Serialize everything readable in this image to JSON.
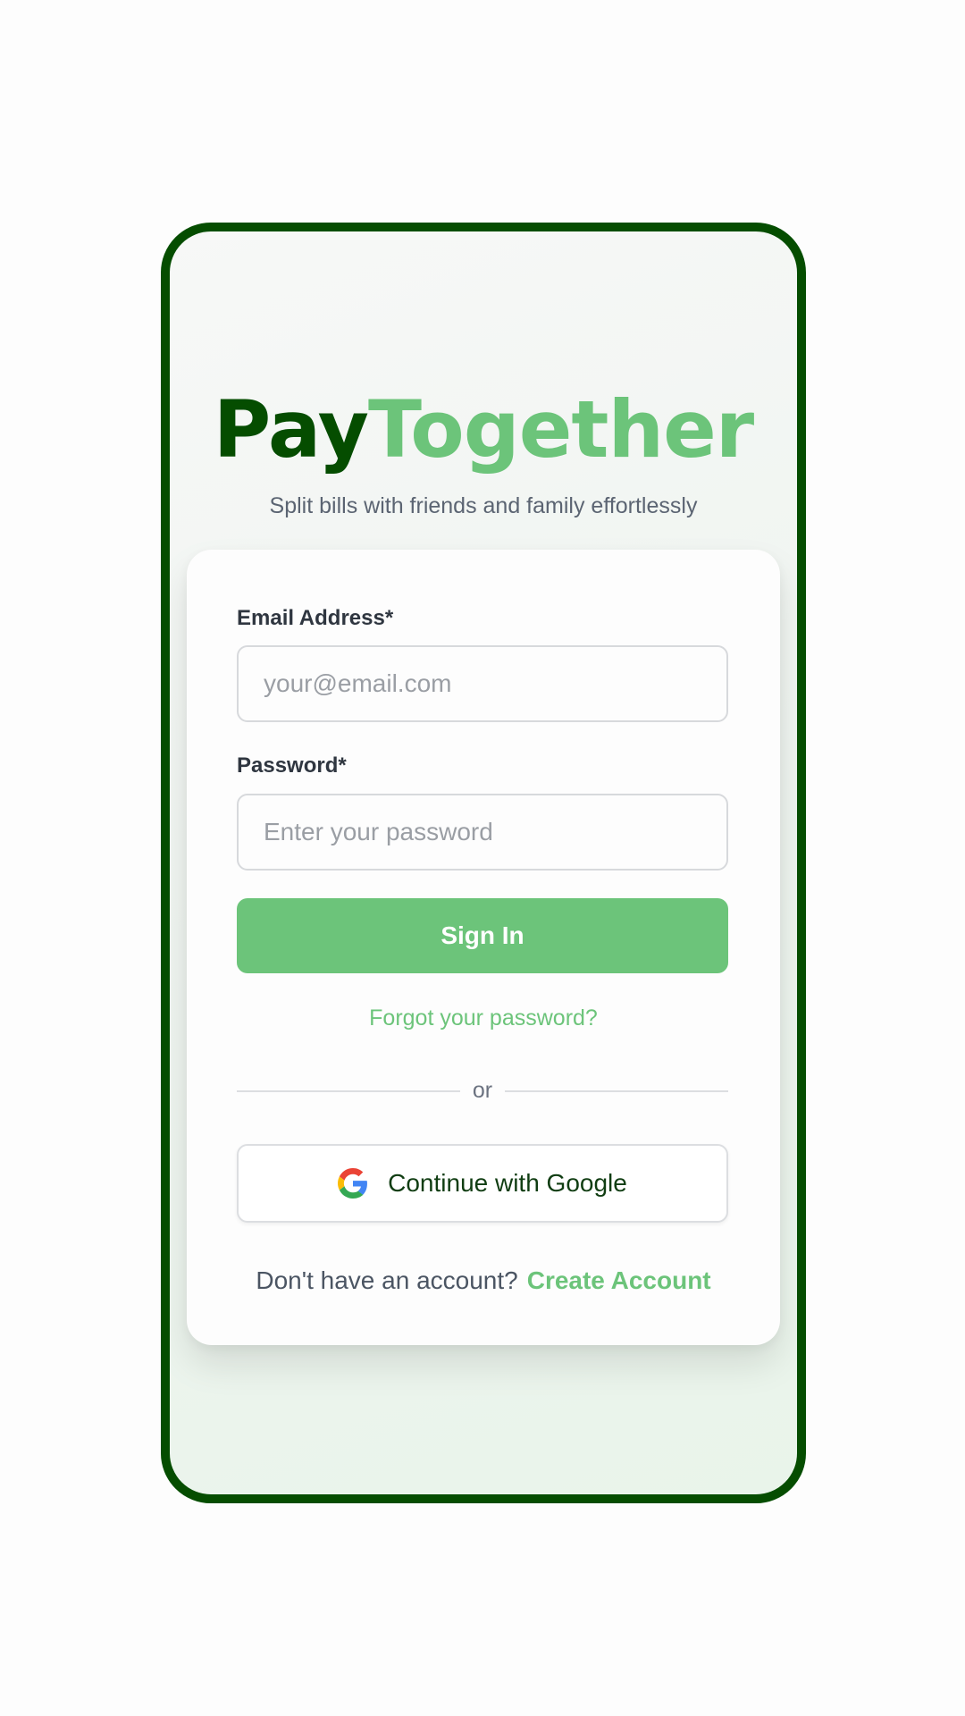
{
  "brand": {
    "part1": "Pay",
    "part2": "Together",
    "tagline": "Split bills with friends and family effortlessly"
  },
  "form": {
    "email_label": "Email Address*",
    "email_placeholder": "your@email.com",
    "email_value": "",
    "password_label": "Password*",
    "password_placeholder": "Enter your password",
    "password_value": "",
    "signin_label": "Sign In",
    "forgot_label": "Forgot your password?",
    "divider_label": "or",
    "google_label": "Continue with Google",
    "google_icon": "google-g-icon",
    "no_account_text": "Don't have an account?",
    "create_account_label": "Create Account"
  },
  "colors": {
    "frame": "#054d00",
    "brand_dark": "#054d00",
    "accent": "#6cc47a",
    "text_muted": "#5b6472"
  }
}
